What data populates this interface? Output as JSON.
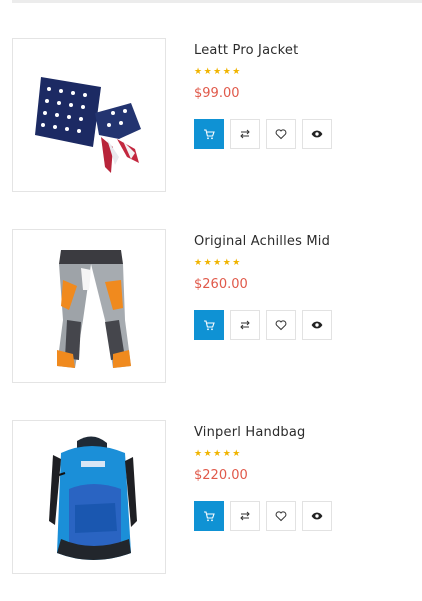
{
  "products": [
    {
      "name": "Leatt Pro Jacket",
      "rating": "★★★★★",
      "price": "$99.00"
    },
    {
      "name": "Original Achilles Mid",
      "rating": "★★★★★",
      "price": "$260.00"
    },
    {
      "name": "Vinperl Handbag",
      "rating": "★★★★★",
      "price": "$220.00"
    }
  ],
  "icons": {
    "cart": "cart-icon",
    "compare": "compare-icon",
    "wishlist": "heart-icon",
    "quickview": "eye-icon"
  },
  "colors": {
    "accent": "#0f92d4",
    "price": "#e0594a",
    "stars": "#f0b400"
  }
}
